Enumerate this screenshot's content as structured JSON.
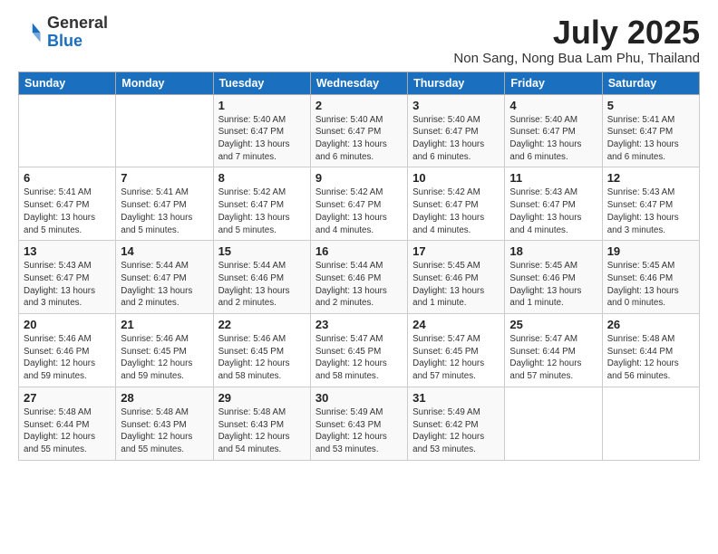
{
  "logo": {
    "general": "General",
    "blue": "Blue"
  },
  "title": {
    "month_year": "July 2025",
    "location": "Non Sang, Nong Bua Lam Phu, Thailand"
  },
  "weekdays": [
    "Sunday",
    "Monday",
    "Tuesday",
    "Wednesday",
    "Thursday",
    "Friday",
    "Saturday"
  ],
  "weeks": [
    [
      {
        "day": "",
        "detail": ""
      },
      {
        "day": "",
        "detail": ""
      },
      {
        "day": "1",
        "detail": "Sunrise: 5:40 AM\nSunset: 6:47 PM\nDaylight: 13 hours\nand 7 minutes."
      },
      {
        "day": "2",
        "detail": "Sunrise: 5:40 AM\nSunset: 6:47 PM\nDaylight: 13 hours\nand 6 minutes."
      },
      {
        "day": "3",
        "detail": "Sunrise: 5:40 AM\nSunset: 6:47 PM\nDaylight: 13 hours\nand 6 minutes."
      },
      {
        "day": "4",
        "detail": "Sunrise: 5:40 AM\nSunset: 6:47 PM\nDaylight: 13 hours\nand 6 minutes."
      },
      {
        "day": "5",
        "detail": "Sunrise: 5:41 AM\nSunset: 6:47 PM\nDaylight: 13 hours\nand 6 minutes."
      }
    ],
    [
      {
        "day": "6",
        "detail": "Sunrise: 5:41 AM\nSunset: 6:47 PM\nDaylight: 13 hours\nand 5 minutes."
      },
      {
        "day": "7",
        "detail": "Sunrise: 5:41 AM\nSunset: 6:47 PM\nDaylight: 13 hours\nand 5 minutes."
      },
      {
        "day": "8",
        "detail": "Sunrise: 5:42 AM\nSunset: 6:47 PM\nDaylight: 13 hours\nand 5 minutes."
      },
      {
        "day": "9",
        "detail": "Sunrise: 5:42 AM\nSunset: 6:47 PM\nDaylight: 13 hours\nand 4 minutes."
      },
      {
        "day": "10",
        "detail": "Sunrise: 5:42 AM\nSunset: 6:47 PM\nDaylight: 13 hours\nand 4 minutes."
      },
      {
        "day": "11",
        "detail": "Sunrise: 5:43 AM\nSunset: 6:47 PM\nDaylight: 13 hours\nand 4 minutes."
      },
      {
        "day": "12",
        "detail": "Sunrise: 5:43 AM\nSunset: 6:47 PM\nDaylight: 13 hours\nand 3 minutes."
      }
    ],
    [
      {
        "day": "13",
        "detail": "Sunrise: 5:43 AM\nSunset: 6:47 PM\nDaylight: 13 hours\nand 3 minutes."
      },
      {
        "day": "14",
        "detail": "Sunrise: 5:44 AM\nSunset: 6:47 PM\nDaylight: 13 hours\nand 2 minutes."
      },
      {
        "day": "15",
        "detail": "Sunrise: 5:44 AM\nSunset: 6:46 PM\nDaylight: 13 hours\nand 2 minutes."
      },
      {
        "day": "16",
        "detail": "Sunrise: 5:44 AM\nSunset: 6:46 PM\nDaylight: 13 hours\nand 2 minutes."
      },
      {
        "day": "17",
        "detail": "Sunrise: 5:45 AM\nSunset: 6:46 PM\nDaylight: 13 hours\nand 1 minute."
      },
      {
        "day": "18",
        "detail": "Sunrise: 5:45 AM\nSunset: 6:46 PM\nDaylight: 13 hours\nand 1 minute."
      },
      {
        "day": "19",
        "detail": "Sunrise: 5:45 AM\nSunset: 6:46 PM\nDaylight: 13 hours\nand 0 minutes."
      }
    ],
    [
      {
        "day": "20",
        "detail": "Sunrise: 5:46 AM\nSunset: 6:46 PM\nDaylight: 12 hours\nand 59 minutes."
      },
      {
        "day": "21",
        "detail": "Sunrise: 5:46 AM\nSunset: 6:45 PM\nDaylight: 12 hours\nand 59 minutes."
      },
      {
        "day": "22",
        "detail": "Sunrise: 5:46 AM\nSunset: 6:45 PM\nDaylight: 12 hours\nand 58 minutes."
      },
      {
        "day": "23",
        "detail": "Sunrise: 5:47 AM\nSunset: 6:45 PM\nDaylight: 12 hours\nand 58 minutes."
      },
      {
        "day": "24",
        "detail": "Sunrise: 5:47 AM\nSunset: 6:45 PM\nDaylight: 12 hours\nand 57 minutes."
      },
      {
        "day": "25",
        "detail": "Sunrise: 5:47 AM\nSunset: 6:44 PM\nDaylight: 12 hours\nand 57 minutes."
      },
      {
        "day": "26",
        "detail": "Sunrise: 5:48 AM\nSunset: 6:44 PM\nDaylight: 12 hours\nand 56 minutes."
      }
    ],
    [
      {
        "day": "27",
        "detail": "Sunrise: 5:48 AM\nSunset: 6:44 PM\nDaylight: 12 hours\nand 55 minutes."
      },
      {
        "day": "28",
        "detail": "Sunrise: 5:48 AM\nSunset: 6:43 PM\nDaylight: 12 hours\nand 55 minutes."
      },
      {
        "day": "29",
        "detail": "Sunrise: 5:48 AM\nSunset: 6:43 PM\nDaylight: 12 hours\nand 54 minutes."
      },
      {
        "day": "30",
        "detail": "Sunrise: 5:49 AM\nSunset: 6:43 PM\nDaylight: 12 hours\nand 53 minutes."
      },
      {
        "day": "31",
        "detail": "Sunrise: 5:49 AM\nSunset: 6:42 PM\nDaylight: 12 hours\nand 53 minutes."
      },
      {
        "day": "",
        "detail": ""
      },
      {
        "day": "",
        "detail": ""
      }
    ]
  ]
}
